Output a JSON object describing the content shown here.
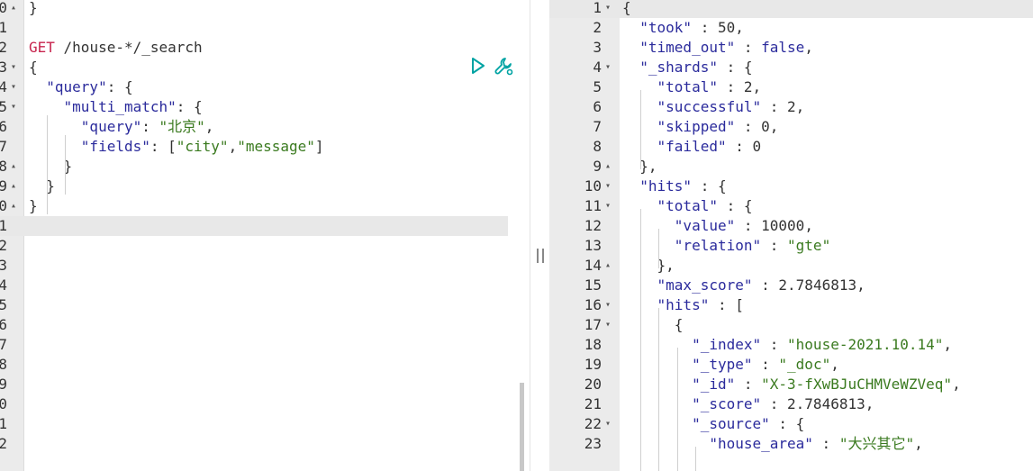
{
  "request_editor": {
    "lines": [
      {
        "ln": "0",
        "fold": "up",
        "tokens": [
          {
            "t": "p",
            "v": "}"
          }
        ]
      },
      {
        "ln": "1",
        "tokens": []
      },
      {
        "ln": "2",
        "tokens": [
          {
            "t": "m",
            "v": "GET"
          },
          {
            "t": "u",
            "v": " /house-*/_search"
          }
        ]
      },
      {
        "ln": "3",
        "fold": "down",
        "tokens": [
          {
            "t": "p",
            "v": "{"
          }
        ]
      },
      {
        "ln": "4",
        "fold": "down",
        "tokens": [
          {
            "t": "p",
            "v": "  "
          },
          {
            "t": "k",
            "v": "\"query\""
          },
          {
            "t": "p",
            "v": ": {"
          }
        ]
      },
      {
        "ln": "5",
        "fold": "down",
        "tokens": [
          {
            "t": "p",
            "v": "    "
          },
          {
            "t": "k",
            "v": "\"multi_match\""
          },
          {
            "t": "p",
            "v": ": {"
          }
        ]
      },
      {
        "ln": "6",
        "tokens": [
          {
            "t": "p",
            "v": "      "
          },
          {
            "t": "k",
            "v": "\"query\""
          },
          {
            "t": "p",
            "v": ": "
          },
          {
            "t": "s",
            "v": "\"北京\""
          },
          {
            "t": "p",
            "v": ","
          }
        ]
      },
      {
        "ln": "7",
        "tokens": [
          {
            "t": "p",
            "v": "      "
          },
          {
            "t": "k",
            "v": "\"fields\""
          },
          {
            "t": "p",
            "v": ": ["
          },
          {
            "t": "s",
            "v": "\"city\""
          },
          {
            "t": "p",
            "v": ","
          },
          {
            "t": "s",
            "v": "\"message\""
          },
          {
            "t": "p",
            "v": "]"
          }
        ]
      },
      {
        "ln": "8",
        "fold": "up",
        "tokens": [
          {
            "t": "p",
            "v": "    }"
          }
        ]
      },
      {
        "ln": "9",
        "fold": "up",
        "tokens": [
          {
            "t": "p",
            "v": "  }"
          }
        ]
      },
      {
        "ln": "0",
        "fold": "up",
        "tokens": [
          {
            "t": "p",
            "v": "}"
          }
        ]
      },
      {
        "ln": "1",
        "active": true,
        "tokens": []
      },
      {
        "ln": "2",
        "tokens": []
      },
      {
        "ln": "3",
        "tokens": []
      },
      {
        "ln": "4",
        "tokens": []
      },
      {
        "ln": "5",
        "tokens": []
      },
      {
        "ln": "6",
        "tokens": []
      },
      {
        "ln": "7",
        "tokens": []
      },
      {
        "ln": "8",
        "tokens": []
      },
      {
        "ln": "9",
        "tokens": []
      },
      {
        "ln": "0",
        "tokens": []
      },
      {
        "ln": "1",
        "tokens": []
      },
      {
        "ln": "2",
        "tokens": []
      }
    ],
    "actions": {
      "run": "play-icon",
      "settings": "wrench-icon"
    },
    "accent": "#00a3a3"
  },
  "response_viewer": {
    "lines": [
      {
        "ln": "1",
        "fold": "down",
        "active": true,
        "tokens": [
          {
            "t": "p",
            "v": "{"
          }
        ]
      },
      {
        "ln": "2",
        "tokens": [
          {
            "t": "p",
            "v": "  "
          },
          {
            "t": "k",
            "v": "\"took\""
          },
          {
            "t": "p",
            "v": " : "
          },
          {
            "t": "n",
            "v": "50"
          },
          {
            "t": "p",
            "v": ","
          }
        ]
      },
      {
        "ln": "3",
        "tokens": [
          {
            "t": "p",
            "v": "  "
          },
          {
            "t": "k",
            "v": "\"timed_out\""
          },
          {
            "t": "p",
            "v": " : "
          },
          {
            "t": "b",
            "v": "false"
          },
          {
            "t": "p",
            "v": ","
          }
        ]
      },
      {
        "ln": "4",
        "fold": "down",
        "tokens": [
          {
            "t": "p",
            "v": "  "
          },
          {
            "t": "k",
            "v": "\"_shards\""
          },
          {
            "t": "p",
            "v": " : {"
          }
        ]
      },
      {
        "ln": "5",
        "tokens": [
          {
            "t": "p",
            "v": "    "
          },
          {
            "t": "k",
            "v": "\"total\""
          },
          {
            "t": "p",
            "v": " : "
          },
          {
            "t": "n",
            "v": "2"
          },
          {
            "t": "p",
            "v": ","
          }
        ]
      },
      {
        "ln": "6",
        "tokens": [
          {
            "t": "p",
            "v": "    "
          },
          {
            "t": "k",
            "v": "\"successful\""
          },
          {
            "t": "p",
            "v": " : "
          },
          {
            "t": "n",
            "v": "2"
          },
          {
            "t": "p",
            "v": ","
          }
        ]
      },
      {
        "ln": "7",
        "tokens": [
          {
            "t": "p",
            "v": "    "
          },
          {
            "t": "k",
            "v": "\"skipped\""
          },
          {
            "t": "p",
            "v": " : "
          },
          {
            "t": "n",
            "v": "0"
          },
          {
            "t": "p",
            "v": ","
          }
        ]
      },
      {
        "ln": "8",
        "tokens": [
          {
            "t": "p",
            "v": "    "
          },
          {
            "t": "k",
            "v": "\"failed\""
          },
          {
            "t": "p",
            "v": " : "
          },
          {
            "t": "n",
            "v": "0"
          }
        ]
      },
      {
        "ln": "9",
        "fold": "up",
        "tokens": [
          {
            "t": "p",
            "v": "  },"
          }
        ]
      },
      {
        "ln": "10",
        "fold": "down",
        "tokens": [
          {
            "t": "p",
            "v": "  "
          },
          {
            "t": "k",
            "v": "\"hits\""
          },
          {
            "t": "p",
            "v": " : {"
          }
        ]
      },
      {
        "ln": "11",
        "fold": "down",
        "tokens": [
          {
            "t": "p",
            "v": "    "
          },
          {
            "t": "k",
            "v": "\"total\""
          },
          {
            "t": "p",
            "v": " : {"
          }
        ]
      },
      {
        "ln": "12",
        "tokens": [
          {
            "t": "p",
            "v": "      "
          },
          {
            "t": "k",
            "v": "\"value\""
          },
          {
            "t": "p",
            "v": " : "
          },
          {
            "t": "n",
            "v": "10000"
          },
          {
            "t": "p",
            "v": ","
          }
        ]
      },
      {
        "ln": "13",
        "tokens": [
          {
            "t": "p",
            "v": "      "
          },
          {
            "t": "k",
            "v": "\"relation\""
          },
          {
            "t": "p",
            "v": " : "
          },
          {
            "t": "s",
            "v": "\"gte\""
          }
        ]
      },
      {
        "ln": "14",
        "fold": "up",
        "tokens": [
          {
            "t": "p",
            "v": "    },"
          }
        ]
      },
      {
        "ln": "15",
        "tokens": [
          {
            "t": "p",
            "v": "    "
          },
          {
            "t": "k",
            "v": "\"max_score\""
          },
          {
            "t": "p",
            "v": " : "
          },
          {
            "t": "n",
            "v": "2.7846813"
          },
          {
            "t": "p",
            "v": ","
          }
        ]
      },
      {
        "ln": "16",
        "fold": "down",
        "tokens": [
          {
            "t": "p",
            "v": "    "
          },
          {
            "t": "k",
            "v": "\"hits\""
          },
          {
            "t": "p",
            "v": " : ["
          }
        ]
      },
      {
        "ln": "17",
        "fold": "down",
        "tokens": [
          {
            "t": "p",
            "v": "      {"
          }
        ]
      },
      {
        "ln": "18",
        "tokens": [
          {
            "t": "p",
            "v": "        "
          },
          {
            "t": "k",
            "v": "\"_index\""
          },
          {
            "t": "p",
            "v": " : "
          },
          {
            "t": "s",
            "v": "\"house-2021.10.14\""
          },
          {
            "t": "p",
            "v": ","
          }
        ]
      },
      {
        "ln": "19",
        "tokens": [
          {
            "t": "p",
            "v": "        "
          },
          {
            "t": "k",
            "v": "\"_type\""
          },
          {
            "t": "p",
            "v": " : "
          },
          {
            "t": "s",
            "v": "\"_doc\""
          },
          {
            "t": "p",
            "v": ","
          }
        ]
      },
      {
        "ln": "20",
        "tokens": [
          {
            "t": "p",
            "v": "        "
          },
          {
            "t": "k",
            "v": "\"_id\""
          },
          {
            "t": "p",
            "v": " : "
          },
          {
            "t": "s",
            "v": "\"X-3-fXwBJuCHMVeWZVeq\""
          },
          {
            "t": "p",
            "v": ","
          }
        ]
      },
      {
        "ln": "21",
        "tokens": [
          {
            "t": "p",
            "v": "        "
          },
          {
            "t": "k",
            "v": "\"_score\""
          },
          {
            "t": "p",
            "v": " : "
          },
          {
            "t": "n",
            "v": "2.7846813"
          },
          {
            "t": "p",
            "v": ","
          }
        ]
      },
      {
        "ln": "22",
        "fold": "down",
        "tokens": [
          {
            "t": "p",
            "v": "        "
          },
          {
            "t": "k",
            "v": "\"_source\""
          },
          {
            "t": "p",
            "v": " : {"
          }
        ]
      },
      {
        "ln": "23",
        "tokens": [
          {
            "t": "p",
            "v": "          "
          },
          {
            "t": "k",
            "v": "\"house_area\""
          },
          {
            "t": "p",
            "v": " : "
          },
          {
            "t": "s",
            "v": "\"大兴其它\""
          },
          {
            "t": "p",
            "v": ","
          }
        ]
      }
    ]
  }
}
